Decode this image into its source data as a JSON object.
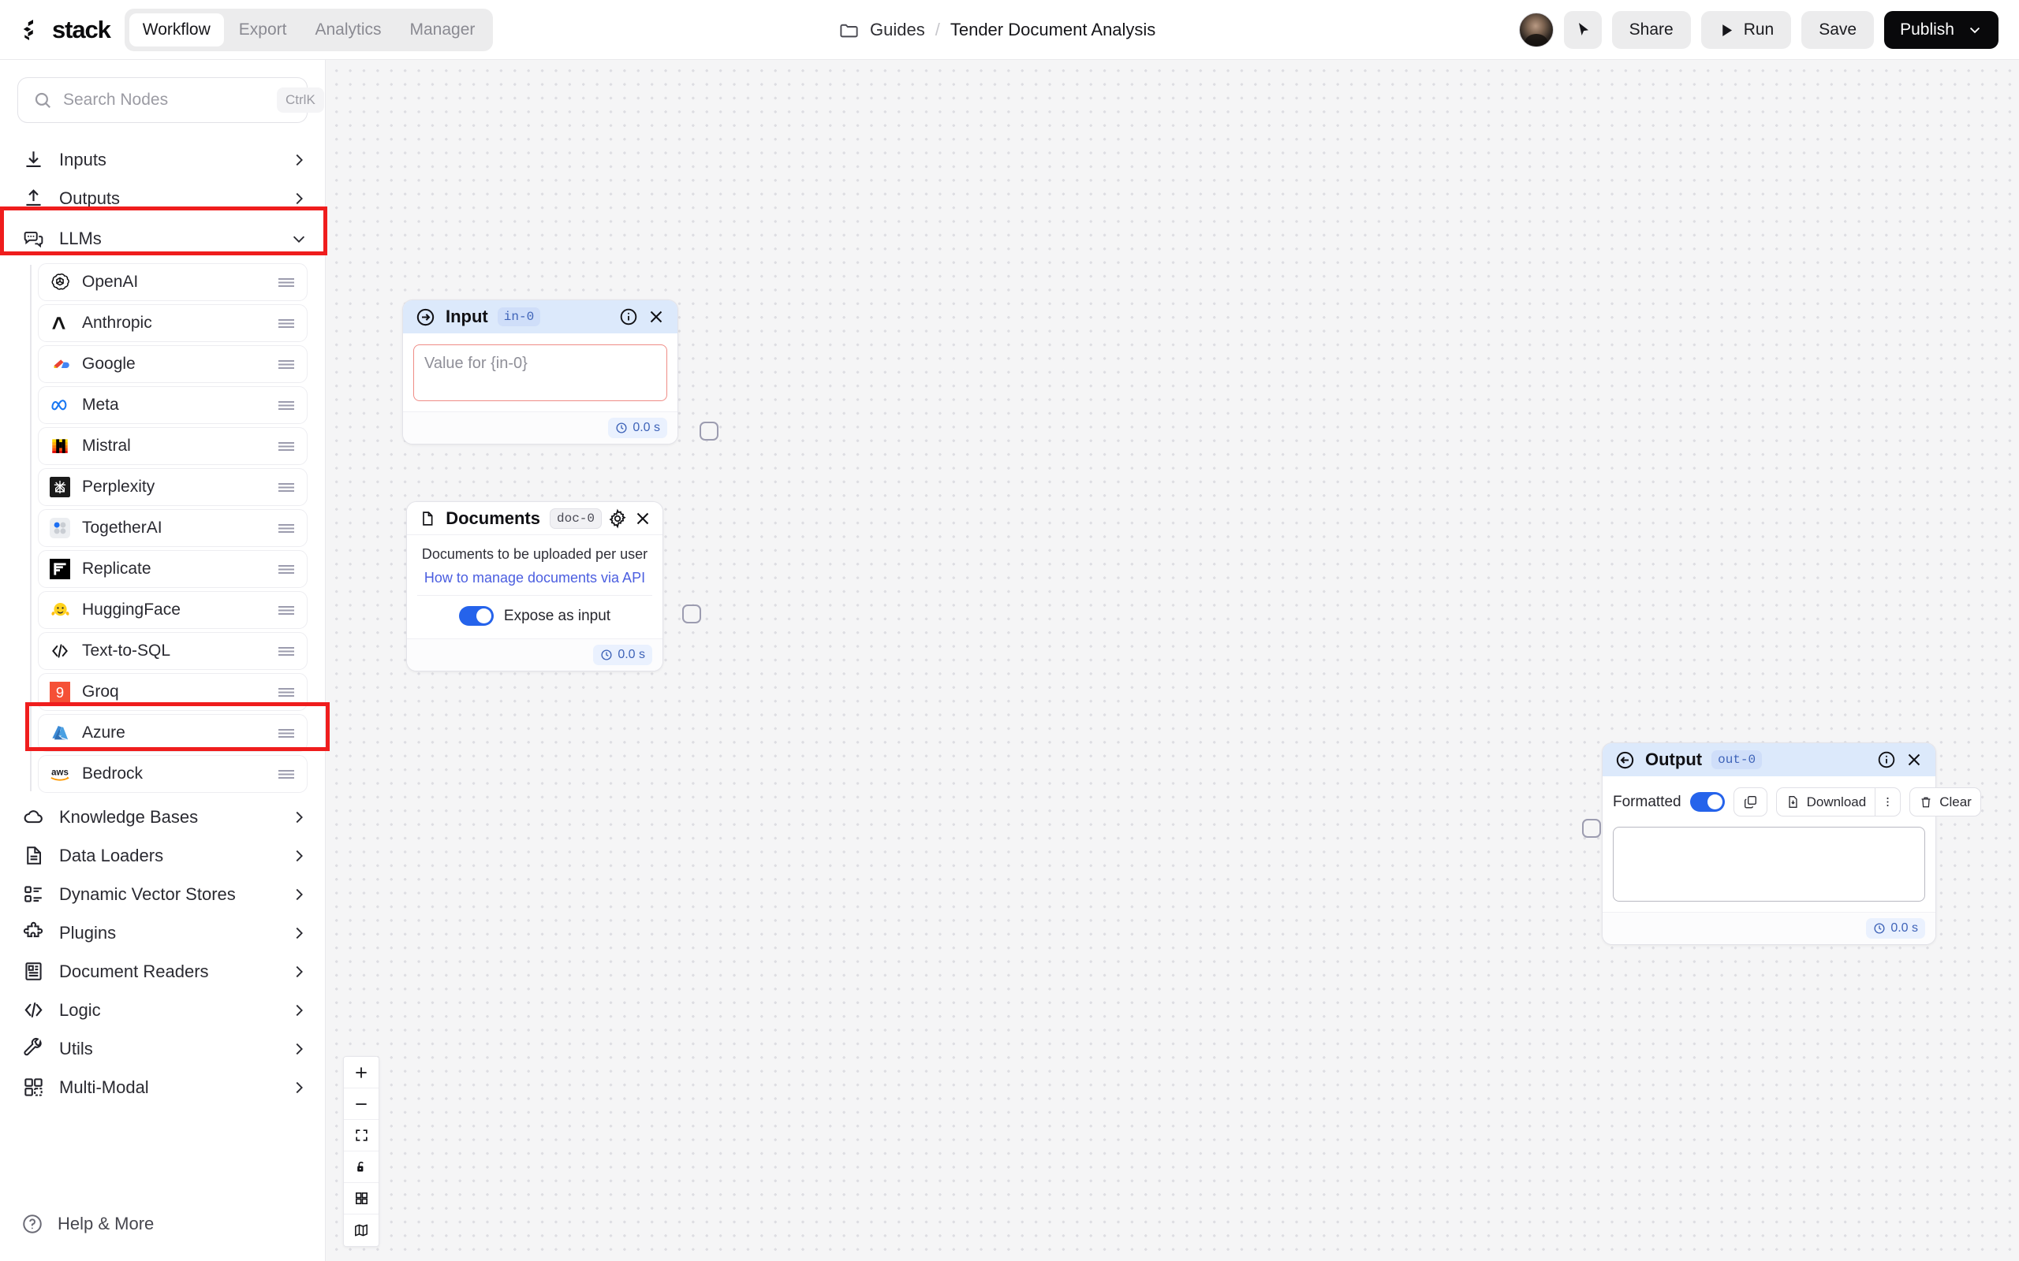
{
  "app": {
    "brand": "stack",
    "nav_tabs": [
      {
        "label": "Workflow",
        "active": true
      },
      {
        "label": "Export",
        "active": false
      },
      {
        "label": "Analytics",
        "active": false
      },
      {
        "label": "Manager",
        "active": false
      }
    ]
  },
  "breadcrumb": {
    "folder_icon": "folder-icon",
    "parent": "Guides",
    "separator": "/",
    "current": "Tender Document Analysis"
  },
  "header_actions": {
    "avatar": "user-avatar",
    "cursor_icon": "cursor-pointer-icon",
    "share_label": "Share",
    "run_label": "Run",
    "run_icon": "play-icon",
    "save_label": "Save",
    "publish_label": "Publish",
    "publish_chevron": "chevron-down-icon"
  },
  "sidebar": {
    "search": {
      "placeholder": "Search Nodes",
      "shortcut": "CtrlK",
      "icon": "search-icon"
    },
    "categories": [
      {
        "label": "Inputs",
        "icon": "download-icon",
        "expanded": false
      },
      {
        "label": "Outputs",
        "icon": "upload-icon",
        "expanded": false
      },
      {
        "label": "LLMs",
        "icon": "chat-bubbles-icon",
        "expanded": true,
        "highlighted": true
      }
    ],
    "llm_providers": [
      {
        "label": "OpenAI",
        "icon": "openai-icon"
      },
      {
        "label": "Anthropic",
        "icon": "anthropic-icon"
      },
      {
        "label": "Google",
        "icon": "google-cloud-icon"
      },
      {
        "label": "Meta",
        "icon": "meta-icon"
      },
      {
        "label": "Mistral",
        "icon": "mistral-icon"
      },
      {
        "label": "Perplexity",
        "icon": "perplexity-icon"
      },
      {
        "label": "TogetherAI",
        "icon": "togetherai-icon"
      },
      {
        "label": "Replicate",
        "icon": "replicate-icon"
      },
      {
        "label": "HuggingFace",
        "icon": "huggingface-icon"
      },
      {
        "label": "Text-to-SQL",
        "icon": "code-brackets-icon"
      },
      {
        "label": "Groq",
        "icon": "groq-icon"
      },
      {
        "label": "Azure",
        "icon": "azure-icon",
        "highlighted": true
      },
      {
        "label": "Bedrock",
        "icon": "aws-icon"
      }
    ],
    "categories_lower": [
      {
        "label": "Knowledge Bases",
        "icon": "cloud-icon"
      },
      {
        "label": "Data Loaders",
        "icon": "file-lines-icon"
      },
      {
        "label": "Dynamic Vector Stores",
        "icon": "list-boxes-icon"
      },
      {
        "label": "Plugins",
        "icon": "puzzle-icon"
      },
      {
        "label": "Document Readers",
        "icon": "document-reader-icon"
      },
      {
        "label": "Logic",
        "icon": "code-brackets-icon"
      },
      {
        "label": "Utils",
        "icon": "wrench-icon"
      },
      {
        "label": "Multi-Modal",
        "icon": "grid-squares-icon"
      }
    ],
    "help": {
      "label": "Help & More",
      "icon": "question-circle-icon"
    }
  },
  "canvas": {
    "nodes": {
      "input": {
        "title": "Input",
        "badge": "in-0",
        "icon": "arrow-right-circle-icon",
        "info_icon": "info-icon",
        "close_icon": "close-icon",
        "field_placeholder": "Value for {in-0}",
        "field_value": "",
        "timer": "0.0 s",
        "timer_icon": "clock-icon"
      },
      "documents": {
        "title": "Documents",
        "badge": "doc-0",
        "icon": "file-icon",
        "settings_icon": "gear-icon",
        "close_icon": "close-icon",
        "caption": "Documents to be uploaded per user",
        "link": "How to manage documents via API",
        "toggle_label": "Expose as input",
        "toggle_on": true,
        "timer": "0.0 s",
        "timer_icon": "clock-icon"
      },
      "output": {
        "title": "Output",
        "badge": "out-0",
        "icon": "arrow-left-circle-icon",
        "info_icon": "info-icon",
        "close_icon": "close-icon",
        "formatted_label": "Formatted",
        "formatted_on": true,
        "copy_icon": "copy-icon",
        "download_label": "Download",
        "download_icon": "download-file-icon",
        "more_icon": "vertical-dots-icon",
        "clear_label": "Clear",
        "clear_icon": "trash-icon",
        "field_value": "",
        "timer": "0.0 s",
        "timer_icon": "clock-icon"
      }
    },
    "controls": [
      {
        "name": "zoom-in",
        "icon": "plus-icon"
      },
      {
        "name": "zoom-out",
        "icon": "minus-icon"
      },
      {
        "name": "fit-view",
        "icon": "fit-view-icon"
      },
      {
        "name": "lock",
        "icon": "unlock-icon"
      },
      {
        "name": "grid",
        "icon": "grid-icon"
      },
      {
        "name": "minimap",
        "icon": "map-icon"
      }
    ]
  },
  "colors": {
    "accent_blue": "#2563eb",
    "node_header_blue": "#dce9fb",
    "highlight_red": "#ef1d1d",
    "publish_black": "#09090b",
    "link_blue": "#4b5ee0"
  }
}
